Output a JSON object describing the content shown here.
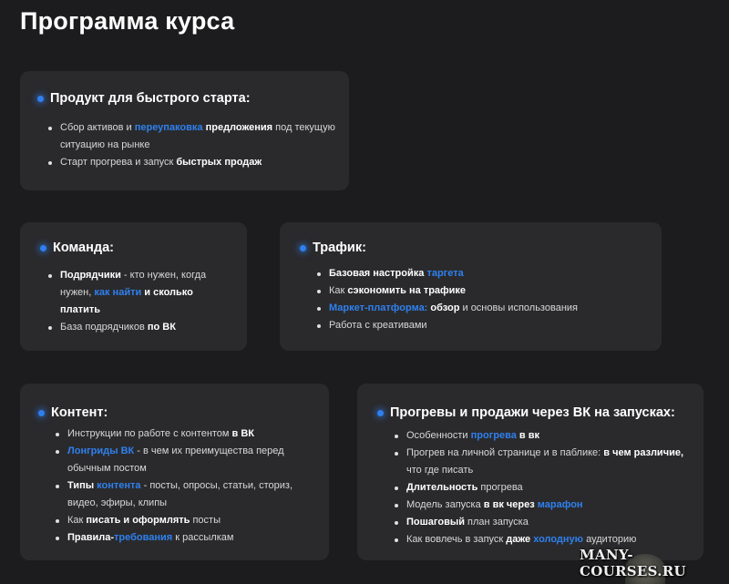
{
  "title": "Программа курса",
  "cards": {
    "product": {
      "title": "Продукт для быстрого старта:",
      "items": [
        [
          {
            "t": "Сбор активов и "
          },
          {
            "t": "переупаковка",
            "s": "hl"
          },
          {
            "t": " "
          },
          {
            "t": "предложения",
            "s": "b"
          },
          {
            "t": " под текущую ситуацию на рынке"
          }
        ],
        [
          {
            "t": "Старт прогрева и запуск "
          },
          {
            "t": "быстрых продаж",
            "s": "b"
          }
        ]
      ]
    },
    "team": {
      "title": "Команда:",
      "items": [
        [
          {
            "t": "Подрядчики",
            "s": "b"
          },
          {
            "t": " - кто нужен, когда нужен, "
          },
          {
            "t": "как найти",
            "s": "hl"
          },
          {
            "t": " "
          },
          {
            "t": "и сколько платить",
            "s": "b"
          }
        ],
        [
          {
            "t": "База подрядчиков "
          },
          {
            "t": "по ВК",
            "s": "b"
          }
        ]
      ]
    },
    "traffic": {
      "title": "Трафик:",
      "items": [
        [
          {
            "t": "Базовая настройка ",
            "s": "b"
          },
          {
            "t": "таргета",
            "s": "hl"
          }
        ],
        [
          {
            "t": "Как "
          },
          {
            "t": "сэкономить на трафике",
            "s": "b"
          }
        ],
        [
          {
            "t": "Маркет-платформа:",
            "s": "hl"
          },
          {
            "t": " "
          },
          {
            "t": "обзор",
            "s": "b"
          },
          {
            "t": " и основы использования"
          }
        ],
        [
          {
            "t": "Работа с креативами"
          }
        ]
      ]
    },
    "content": {
      "title": "Контент:",
      "items": [
        [
          {
            "t": "Инструкции по работе с контентом "
          },
          {
            "t": "в ВК",
            "s": "b"
          }
        ],
        [
          {
            "t": "Лонгриды ВК",
            "s": "hl"
          },
          {
            "t": " - в чем их преимущества перед обычным постом"
          }
        ],
        [
          {
            "t": "Типы",
            "s": "b"
          },
          {
            "t": " "
          },
          {
            "t": "контента",
            "s": "hl"
          },
          {
            "t": " - посты, опросы, статьи, сториз, видео, эфиры, клипы"
          }
        ],
        [
          {
            "t": "Как "
          },
          {
            "t": "писать и оформлять",
            "s": "b"
          },
          {
            "t": " посты"
          }
        ],
        [
          {
            "t": "Правила-",
            "s": "b"
          },
          {
            "t": "требования",
            "s": "hl"
          },
          {
            "t": " к рассылкам"
          }
        ]
      ]
    },
    "launch": {
      "title": "Прогревы и продажи через ВК на запусках:",
      "items": [
        [
          {
            "t": "Особенности "
          },
          {
            "t": "прогрева",
            "s": "hl"
          },
          {
            "t": " "
          },
          {
            "t": "в вк",
            "s": "b"
          }
        ],
        [
          {
            "t": "Прогрев на личной странице и в паблике: "
          },
          {
            "t": "в чем различие,",
            "s": "b"
          },
          {
            "t": " что где писать"
          }
        ],
        [
          {
            "t": "Длительность",
            "s": "b"
          },
          {
            "t": " прогрева"
          }
        ],
        [
          {
            "t": "Модель запуска "
          },
          {
            "t": "в вк через",
            "s": "b"
          },
          {
            "t": " "
          },
          {
            "t": "марафон",
            "s": "hl"
          }
        ],
        [
          {
            "t": "Пошаговый",
            "s": "b"
          },
          {
            "t": " план запуска"
          }
        ],
        [
          {
            "t": "Как вовлечь в запуск "
          },
          {
            "t": "даже",
            "s": "b"
          },
          {
            "t": " "
          },
          {
            "t": "холодную",
            "s": "hl"
          },
          {
            "t": " аудиторию"
          }
        ]
      ]
    }
  },
  "watermark": "MANY-COURSES.RU",
  "colors": {
    "background": "#1c1c1e",
    "card": "#2a2a2d",
    "accent": "#2f80ed"
  }
}
